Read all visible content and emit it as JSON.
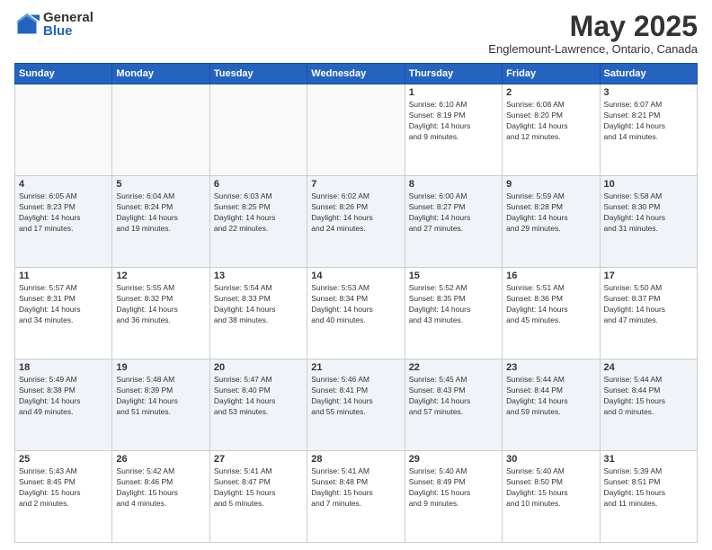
{
  "logo": {
    "general": "General",
    "blue": "Blue"
  },
  "title": "May 2025",
  "subtitle": "Englemount-Lawrence, Ontario, Canada",
  "days_header": [
    "Sunday",
    "Monday",
    "Tuesday",
    "Wednesday",
    "Thursday",
    "Friday",
    "Saturday"
  ],
  "weeks": [
    [
      {
        "day": "",
        "info": ""
      },
      {
        "day": "",
        "info": ""
      },
      {
        "day": "",
        "info": ""
      },
      {
        "day": "",
        "info": ""
      },
      {
        "day": "1",
        "info": "Sunrise: 6:10 AM\nSunset: 8:19 PM\nDaylight: 14 hours\nand 9 minutes."
      },
      {
        "day": "2",
        "info": "Sunrise: 6:08 AM\nSunset: 8:20 PM\nDaylight: 14 hours\nand 12 minutes."
      },
      {
        "day": "3",
        "info": "Sunrise: 6:07 AM\nSunset: 8:21 PM\nDaylight: 14 hours\nand 14 minutes."
      }
    ],
    [
      {
        "day": "4",
        "info": "Sunrise: 6:05 AM\nSunset: 8:23 PM\nDaylight: 14 hours\nand 17 minutes."
      },
      {
        "day": "5",
        "info": "Sunrise: 6:04 AM\nSunset: 8:24 PM\nDaylight: 14 hours\nand 19 minutes."
      },
      {
        "day": "6",
        "info": "Sunrise: 6:03 AM\nSunset: 8:25 PM\nDaylight: 14 hours\nand 22 minutes."
      },
      {
        "day": "7",
        "info": "Sunrise: 6:02 AM\nSunset: 8:26 PM\nDaylight: 14 hours\nand 24 minutes."
      },
      {
        "day": "8",
        "info": "Sunrise: 6:00 AM\nSunset: 8:27 PM\nDaylight: 14 hours\nand 27 minutes."
      },
      {
        "day": "9",
        "info": "Sunrise: 5:59 AM\nSunset: 8:28 PM\nDaylight: 14 hours\nand 29 minutes."
      },
      {
        "day": "10",
        "info": "Sunrise: 5:58 AM\nSunset: 8:30 PM\nDaylight: 14 hours\nand 31 minutes."
      }
    ],
    [
      {
        "day": "11",
        "info": "Sunrise: 5:57 AM\nSunset: 8:31 PM\nDaylight: 14 hours\nand 34 minutes."
      },
      {
        "day": "12",
        "info": "Sunrise: 5:55 AM\nSunset: 8:32 PM\nDaylight: 14 hours\nand 36 minutes."
      },
      {
        "day": "13",
        "info": "Sunrise: 5:54 AM\nSunset: 8:33 PM\nDaylight: 14 hours\nand 38 minutes."
      },
      {
        "day": "14",
        "info": "Sunrise: 5:53 AM\nSunset: 8:34 PM\nDaylight: 14 hours\nand 40 minutes."
      },
      {
        "day": "15",
        "info": "Sunrise: 5:52 AM\nSunset: 8:35 PM\nDaylight: 14 hours\nand 43 minutes."
      },
      {
        "day": "16",
        "info": "Sunrise: 5:51 AM\nSunset: 8:36 PM\nDaylight: 14 hours\nand 45 minutes."
      },
      {
        "day": "17",
        "info": "Sunrise: 5:50 AM\nSunset: 8:37 PM\nDaylight: 14 hours\nand 47 minutes."
      }
    ],
    [
      {
        "day": "18",
        "info": "Sunrise: 5:49 AM\nSunset: 8:38 PM\nDaylight: 14 hours\nand 49 minutes."
      },
      {
        "day": "19",
        "info": "Sunrise: 5:48 AM\nSunset: 8:39 PM\nDaylight: 14 hours\nand 51 minutes."
      },
      {
        "day": "20",
        "info": "Sunrise: 5:47 AM\nSunset: 8:40 PM\nDaylight: 14 hours\nand 53 minutes."
      },
      {
        "day": "21",
        "info": "Sunrise: 5:46 AM\nSunset: 8:41 PM\nDaylight: 14 hours\nand 55 minutes."
      },
      {
        "day": "22",
        "info": "Sunrise: 5:45 AM\nSunset: 8:43 PM\nDaylight: 14 hours\nand 57 minutes."
      },
      {
        "day": "23",
        "info": "Sunrise: 5:44 AM\nSunset: 8:44 PM\nDaylight: 14 hours\nand 59 minutes."
      },
      {
        "day": "24",
        "info": "Sunrise: 5:44 AM\nSunset: 8:44 PM\nDaylight: 15 hours\nand 0 minutes."
      }
    ],
    [
      {
        "day": "25",
        "info": "Sunrise: 5:43 AM\nSunset: 8:45 PM\nDaylight: 15 hours\nand 2 minutes."
      },
      {
        "day": "26",
        "info": "Sunrise: 5:42 AM\nSunset: 8:46 PM\nDaylight: 15 hours\nand 4 minutes."
      },
      {
        "day": "27",
        "info": "Sunrise: 5:41 AM\nSunset: 8:47 PM\nDaylight: 15 hours\nand 5 minutes."
      },
      {
        "day": "28",
        "info": "Sunrise: 5:41 AM\nSunset: 8:48 PM\nDaylight: 15 hours\nand 7 minutes."
      },
      {
        "day": "29",
        "info": "Sunrise: 5:40 AM\nSunset: 8:49 PM\nDaylight: 15 hours\nand 9 minutes."
      },
      {
        "day": "30",
        "info": "Sunrise: 5:40 AM\nSunset: 8:50 PM\nDaylight: 15 hours\nand 10 minutes."
      },
      {
        "day": "31",
        "info": "Sunrise: 5:39 AM\nSunset: 8:51 PM\nDaylight: 15 hours\nand 11 minutes."
      }
    ]
  ]
}
